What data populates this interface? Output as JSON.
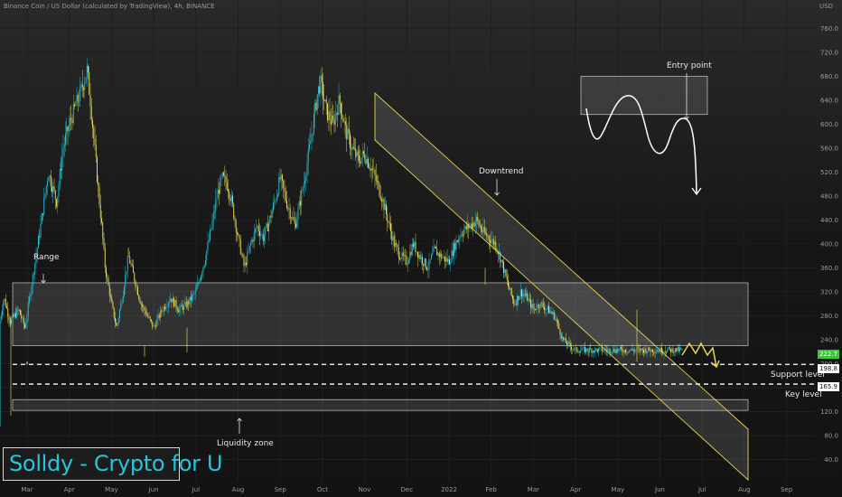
{
  "header": {
    "title": "Binance Coin / US Dollar (calculated by TradingView), 4h, BINANCE",
    "currency": "USD"
  },
  "branding": {
    "text": "Solldy - Crypto for U"
  },
  "annotations": {
    "range": "Range",
    "entry_point": "Entry point",
    "downtrend": "Downtrend",
    "support_level": "Support level",
    "key_level": "Key level",
    "liquidity_zone": "Liquidity zone"
  },
  "price_tags": {
    "current": "222.7",
    "support": "198.8",
    "key": "165.9"
  },
  "colors": {
    "background": "#131313",
    "candle_up": "#26c6da",
    "candle_down": "#f2e85a",
    "accent_yellow": "#e8d44d",
    "current_price_bg": "#3cc43c",
    "zone_fill": "rgba(200,200,200,0.16)",
    "zone_border": "#c9c9c9"
  },
  "chart_data": {
    "type": "candlestick",
    "symbol": "BNBUSD",
    "timeframe": "4h",
    "y_axis": {
      "ticks": [
        40,
        80,
        120,
        160,
        200,
        240,
        280,
        320,
        360,
        400,
        440,
        480,
        520,
        560,
        600,
        640,
        680,
        720,
        760
      ],
      "tick_labels": [
        "40.0",
        "80.0",
        "120.0",
        "160.0",
        "200.0",
        "240.0",
        "280.0",
        "320.0",
        "360.0",
        "400.0",
        "440.0",
        "480.0",
        "520.0",
        "560.0",
        "600.0",
        "640.0",
        "680.0",
        "720.0",
        "760.0"
      ],
      "range": [
        15,
        790
      ]
    },
    "x_axis": {
      "ticks": [
        "Mar",
        "Apr",
        "May",
        "Jun",
        "Jul",
        "Aug",
        "Sep",
        "Oct",
        "Nov",
        "Dec",
        "2022",
        "Feb",
        "Mar",
        "Apr",
        "May",
        "Jun",
        "Jul",
        "Aug",
        "Sep"
      ],
      "tick_months": [
        1,
        2,
        3,
        4,
        5,
        6,
        7,
        8,
        9,
        10,
        11,
        12,
        13,
        14,
        15,
        16,
        17,
        18,
        19
      ]
    },
    "price_path": [
      [
        0.0,
        95
      ],
      [
        0.05,
        110
      ],
      [
        0.12,
        160
      ],
      [
        0.2,
        280
      ],
      [
        0.3,
        250
      ],
      [
        0.45,
        310
      ],
      [
        0.6,
        270
      ],
      [
        0.8,
        290
      ],
      [
        0.95,
        260
      ],
      [
        1.1,
        330
      ],
      [
        1.3,
        420
      ],
      [
        1.5,
        520
      ],
      [
        1.7,
        470
      ],
      [
        1.85,
        560
      ],
      [
        2.0,
        600
      ],
      [
        2.15,
        630
      ],
      [
        2.3,
        660
      ],
      [
        2.42,
        690
      ],
      [
        2.5,
        640
      ],
      [
        2.6,
        560
      ],
      [
        2.7,
        480
      ],
      [
        2.78,
        420
      ],
      [
        2.85,
        360
      ],
      [
        3.0,
        300
      ],
      [
        3.12,
        260
      ],
      [
        3.25,
        310
      ],
      [
        3.4,
        380
      ],
      [
        3.55,
        340
      ],
      [
        3.7,
        300
      ],
      [
        3.85,
        280
      ],
      [
        4.0,
        260
      ],
      [
        4.2,
        290
      ],
      [
        4.4,
        310
      ],
      [
        4.6,
        290
      ],
      [
        4.8,
        300
      ],
      [
        5.0,
        320
      ],
      [
        5.2,
        370
      ],
      [
        5.35,
        420
      ],
      [
        5.5,
        480
      ],
      [
        5.62,
        510
      ],
      [
        5.75,
        500
      ],
      [
        5.85,
        470
      ],
      [
        6.0,
        410
      ],
      [
        6.15,
        360
      ],
      [
        6.3,
        400
      ],
      [
        6.45,
        430
      ],
      [
        6.6,
        410
      ],
      [
        6.75,
        440
      ],
      [
        6.9,
        480
      ],
      [
        7.0,
        510
      ],
      [
        7.15,
        470
      ],
      [
        7.35,
        430
      ],
      [
        7.5,
        480
      ],
      [
        7.65,
        540
      ],
      [
        7.78,
        600
      ],
      [
        7.88,
        650
      ],
      [
        7.95,
        670
      ],
      [
        8.1,
        620
      ],
      [
        8.25,
        600
      ],
      [
        8.4,
        640
      ],
      [
        8.55,
        590
      ],
      [
        8.7,
        560
      ],
      [
        8.85,
        540
      ],
      [
        9.0,
        550
      ],
      [
        9.2,
        520
      ],
      [
        9.4,
        480
      ],
      [
        9.55,
        440
      ],
      [
        9.7,
        400
      ],
      [
        9.85,
        380
      ],
      [
        10.0,
        370
      ],
      [
        10.15,
        400
      ],
      [
        10.3,
        380
      ],
      [
        10.5,
        360
      ],
      [
        10.65,
        390
      ],
      [
        10.8,
        380
      ],
      [
        11.0,
        370
      ],
      [
        11.15,
        400
      ],
      [
        11.3,
        420
      ],
      [
        11.5,
        430
      ],
      [
        11.65,
        440
      ],
      [
        11.8,
        420
      ],
      [
        11.95,
        410
      ],
      [
        12.1,
        400
      ],
      [
        12.25,
        370
      ],
      [
        12.4,
        330
      ],
      [
        12.55,
        300
      ],
      [
        12.7,
        320
      ],
      [
        12.85,
        310
      ],
      [
        13.0,
        290
      ],
      [
        13.15,
        300
      ],
      [
        13.35,
        290
      ],
      [
        13.5,
        280
      ],
      [
        13.7,
        240
      ],
      [
        13.85,
        230
      ],
      [
        14.0,
        222.7
      ]
    ],
    "projections": {
      "current_price": 222.7,
      "target": 198.8
    },
    "levels": [
      {
        "name": "Support level",
        "price": 198.8
      },
      {
        "name": "Key level",
        "price": 165.9
      }
    ],
    "zones": [
      {
        "name": "Range",
        "price_top": 335,
        "price_bottom": 230
      },
      {
        "name": "Liquidity zone",
        "price_top": 140,
        "price_bottom": 122
      },
      {
        "name": "Entry point",
        "price_top": 680,
        "price_bottom": 616
      }
    ]
  }
}
